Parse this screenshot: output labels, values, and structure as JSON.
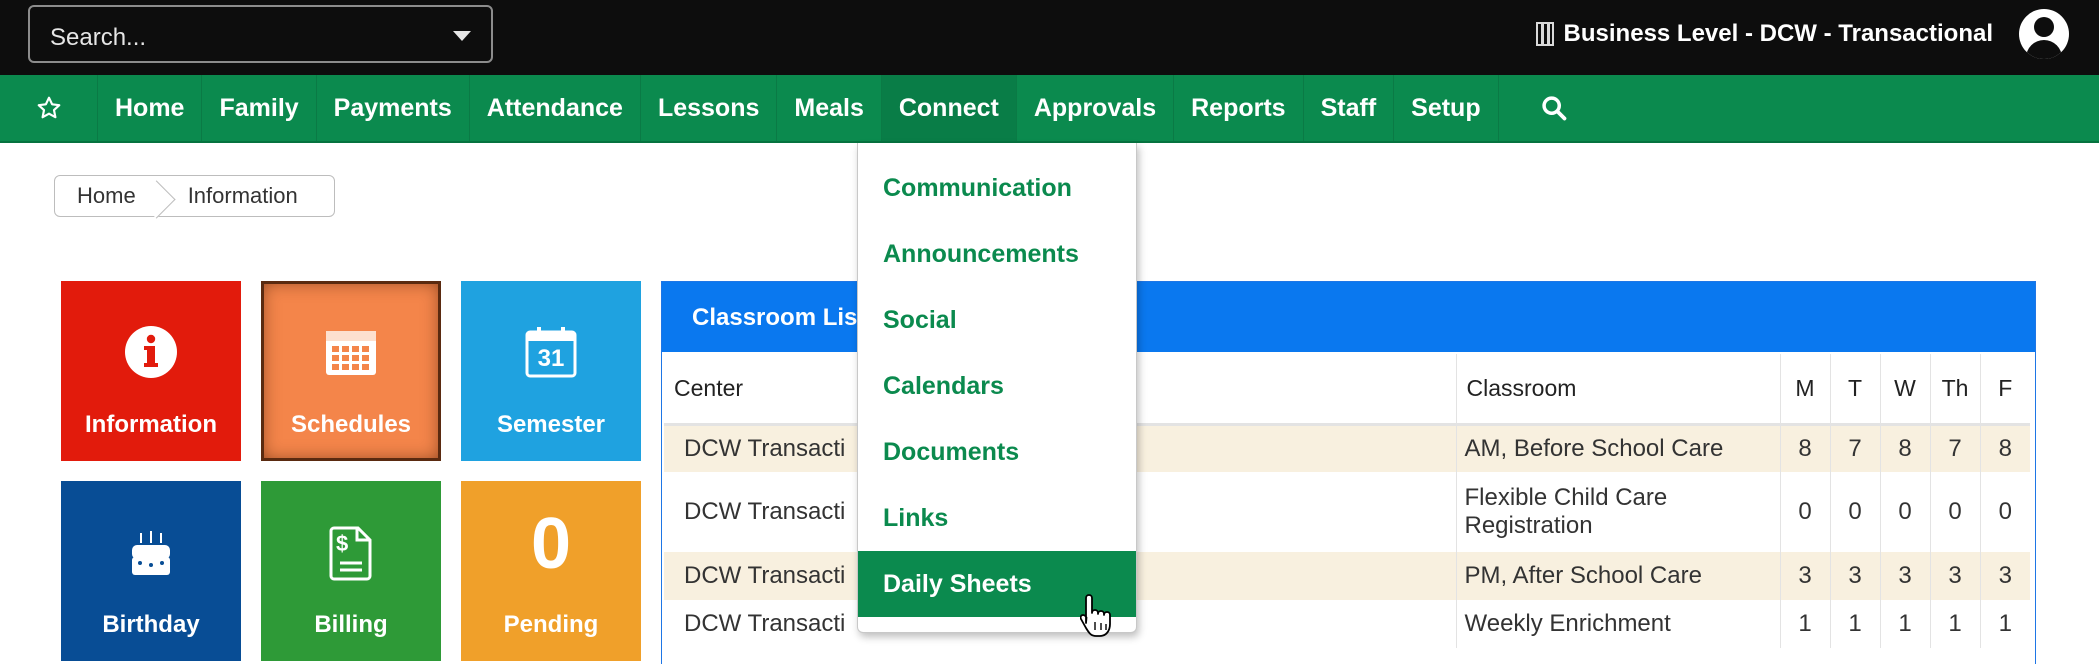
{
  "topbar": {
    "search_placeholder": "Search...",
    "business_label": "Business Level - DCW - Transactional"
  },
  "nav": {
    "items": [
      {
        "label": "Home"
      },
      {
        "label": "Family"
      },
      {
        "label": "Payments"
      },
      {
        "label": "Attendance"
      },
      {
        "label": "Lessons"
      },
      {
        "label": "Meals"
      },
      {
        "label": "Connect"
      },
      {
        "label": "Approvals"
      },
      {
        "label": "Reports"
      },
      {
        "label": "Staff"
      },
      {
        "label": "Setup"
      }
    ]
  },
  "breadcrumb": {
    "items": [
      "Home",
      "Information"
    ]
  },
  "tiles": [
    {
      "label": "Information",
      "color": "#e21b0c",
      "icon": "info-icon"
    },
    {
      "label": "Schedules",
      "color": "#f4854a",
      "icon": "calendar-grid-icon"
    },
    {
      "label": "Semester",
      "color": "#1fa2e0",
      "icon": "calendar-31-icon",
      "icon_text": "31"
    },
    {
      "label": "Birthday",
      "color": "#084d95",
      "icon": "birthday-cake-icon"
    },
    {
      "label": "Billing",
      "color": "#2e9a37",
      "icon": "invoice-dollar-icon",
      "icon_text": "$"
    },
    {
      "label": "Pending",
      "color": "#f0a02a",
      "icon": "count",
      "count": "0"
    }
  ],
  "classroom_list": {
    "title": "Classroom List",
    "columns": [
      "Center",
      "Classroom",
      "M",
      "T",
      "W",
      "Th",
      "F"
    ],
    "rows": [
      {
        "center": "DCW Transacti",
        "classroom": "AM, Before School Care",
        "m": "8",
        "t": "7",
        "w": "8",
        "th": "7",
        "f": "8"
      },
      {
        "center": "DCW Transacti",
        "classroom": "Flexible Child Care Registration",
        "m": "0",
        "t": "0",
        "w": "0",
        "th": "0",
        "f": "0"
      },
      {
        "center": "DCW Transacti",
        "classroom": "PM, After School Care",
        "m": "3",
        "t": "3",
        "w": "3",
        "th": "3",
        "f": "3"
      },
      {
        "center": "DCW Transacti",
        "classroom": "Weekly Enrichment",
        "m": "1",
        "t": "1",
        "w": "1",
        "th": "1",
        "f": "1"
      }
    ]
  },
  "connect_menu": {
    "items": [
      {
        "label": "Communication"
      },
      {
        "label": "Announcements"
      },
      {
        "label": "Social"
      },
      {
        "label": "Calendars"
      },
      {
        "label": "Documents"
      },
      {
        "label": "Links"
      },
      {
        "label": "Daily Sheets"
      }
    ],
    "hovered": "Daily Sheets"
  },
  "colors": {
    "nav_green": "#0b8a4e",
    "topbar": "#0d0d0d",
    "panel_blue": "#0a78ef",
    "row_stripe": "#f8f0df"
  }
}
